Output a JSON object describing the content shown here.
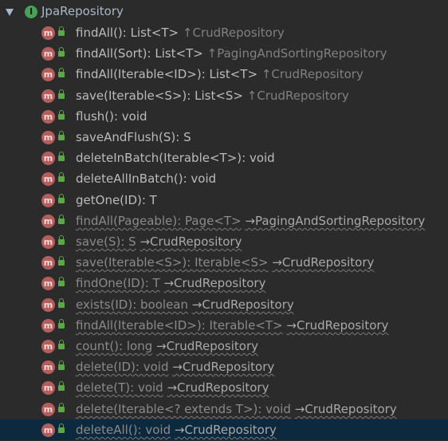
{
  "root": {
    "label": "JpaRepository",
    "icon": "interface-icon",
    "icon_letter": "I"
  },
  "method_icon_letter": "m",
  "rows": [
    {
      "sig": "findAll(): List<T>",
      "tag": "↑CrudRepository",
      "deprecated": false
    },
    {
      "sig": "findAll(Sort): List<T>",
      "tag": "↑PagingAndSortingRepository",
      "deprecated": false
    },
    {
      "sig": "findAll(Iterable<ID>): List<T>",
      "tag": "↑CrudRepository",
      "deprecated": false
    },
    {
      "sig": "save(Iterable<S>): List<S>",
      "tag": "↑CrudRepository",
      "deprecated": false
    },
    {
      "sig": "flush(): void",
      "tag": "",
      "deprecated": false
    },
    {
      "sig": "saveAndFlush(S): S",
      "tag": "",
      "deprecated": false
    },
    {
      "sig": "deleteInBatch(Iterable<T>): void",
      "tag": "",
      "deprecated": false
    },
    {
      "sig": "deleteAllInBatch(): void",
      "tag": "",
      "deprecated": false
    },
    {
      "sig": "getOne(ID): T",
      "tag": "",
      "deprecated": false
    },
    {
      "sig": "findAll(Pageable): Page<T>",
      "tag": "→PagingAndSortingRepository",
      "deprecated": true
    },
    {
      "sig": "save(S): S",
      "tag": "→CrudRepository",
      "deprecated": true
    },
    {
      "sig": "save(Iterable<S>): Iterable<S>",
      "tag": "→CrudRepository",
      "deprecated": true
    },
    {
      "sig": "findOne(ID): T",
      "tag": "→CrudRepository",
      "deprecated": true
    },
    {
      "sig": "exists(ID): boolean",
      "tag": "→CrudRepository",
      "deprecated": true
    },
    {
      "sig": "findAll(Iterable<ID>): Iterable<T>",
      "tag": "→CrudRepository",
      "deprecated": true
    },
    {
      "sig": "count(): long",
      "tag": "→CrudRepository",
      "deprecated": true
    },
    {
      "sig": "delete(ID): void",
      "tag": "→CrudRepository",
      "deprecated": true
    },
    {
      "sig": "delete(T): void",
      "tag": "→CrudRepository",
      "deprecated": true
    },
    {
      "sig": "delete(Iterable<? extends T>): void",
      "tag": "→CrudRepository",
      "deprecated": true
    },
    {
      "sig": "deleteAll(): void",
      "tag": "→CrudRepository",
      "deprecated": true,
      "selected": true
    }
  ],
  "colors": {
    "background": "#2b2b2b",
    "selection": "#0d293e",
    "method_icon": "#b35d5d",
    "lock_icon": "#5aa846",
    "interface_icon": "#48a155"
  }
}
